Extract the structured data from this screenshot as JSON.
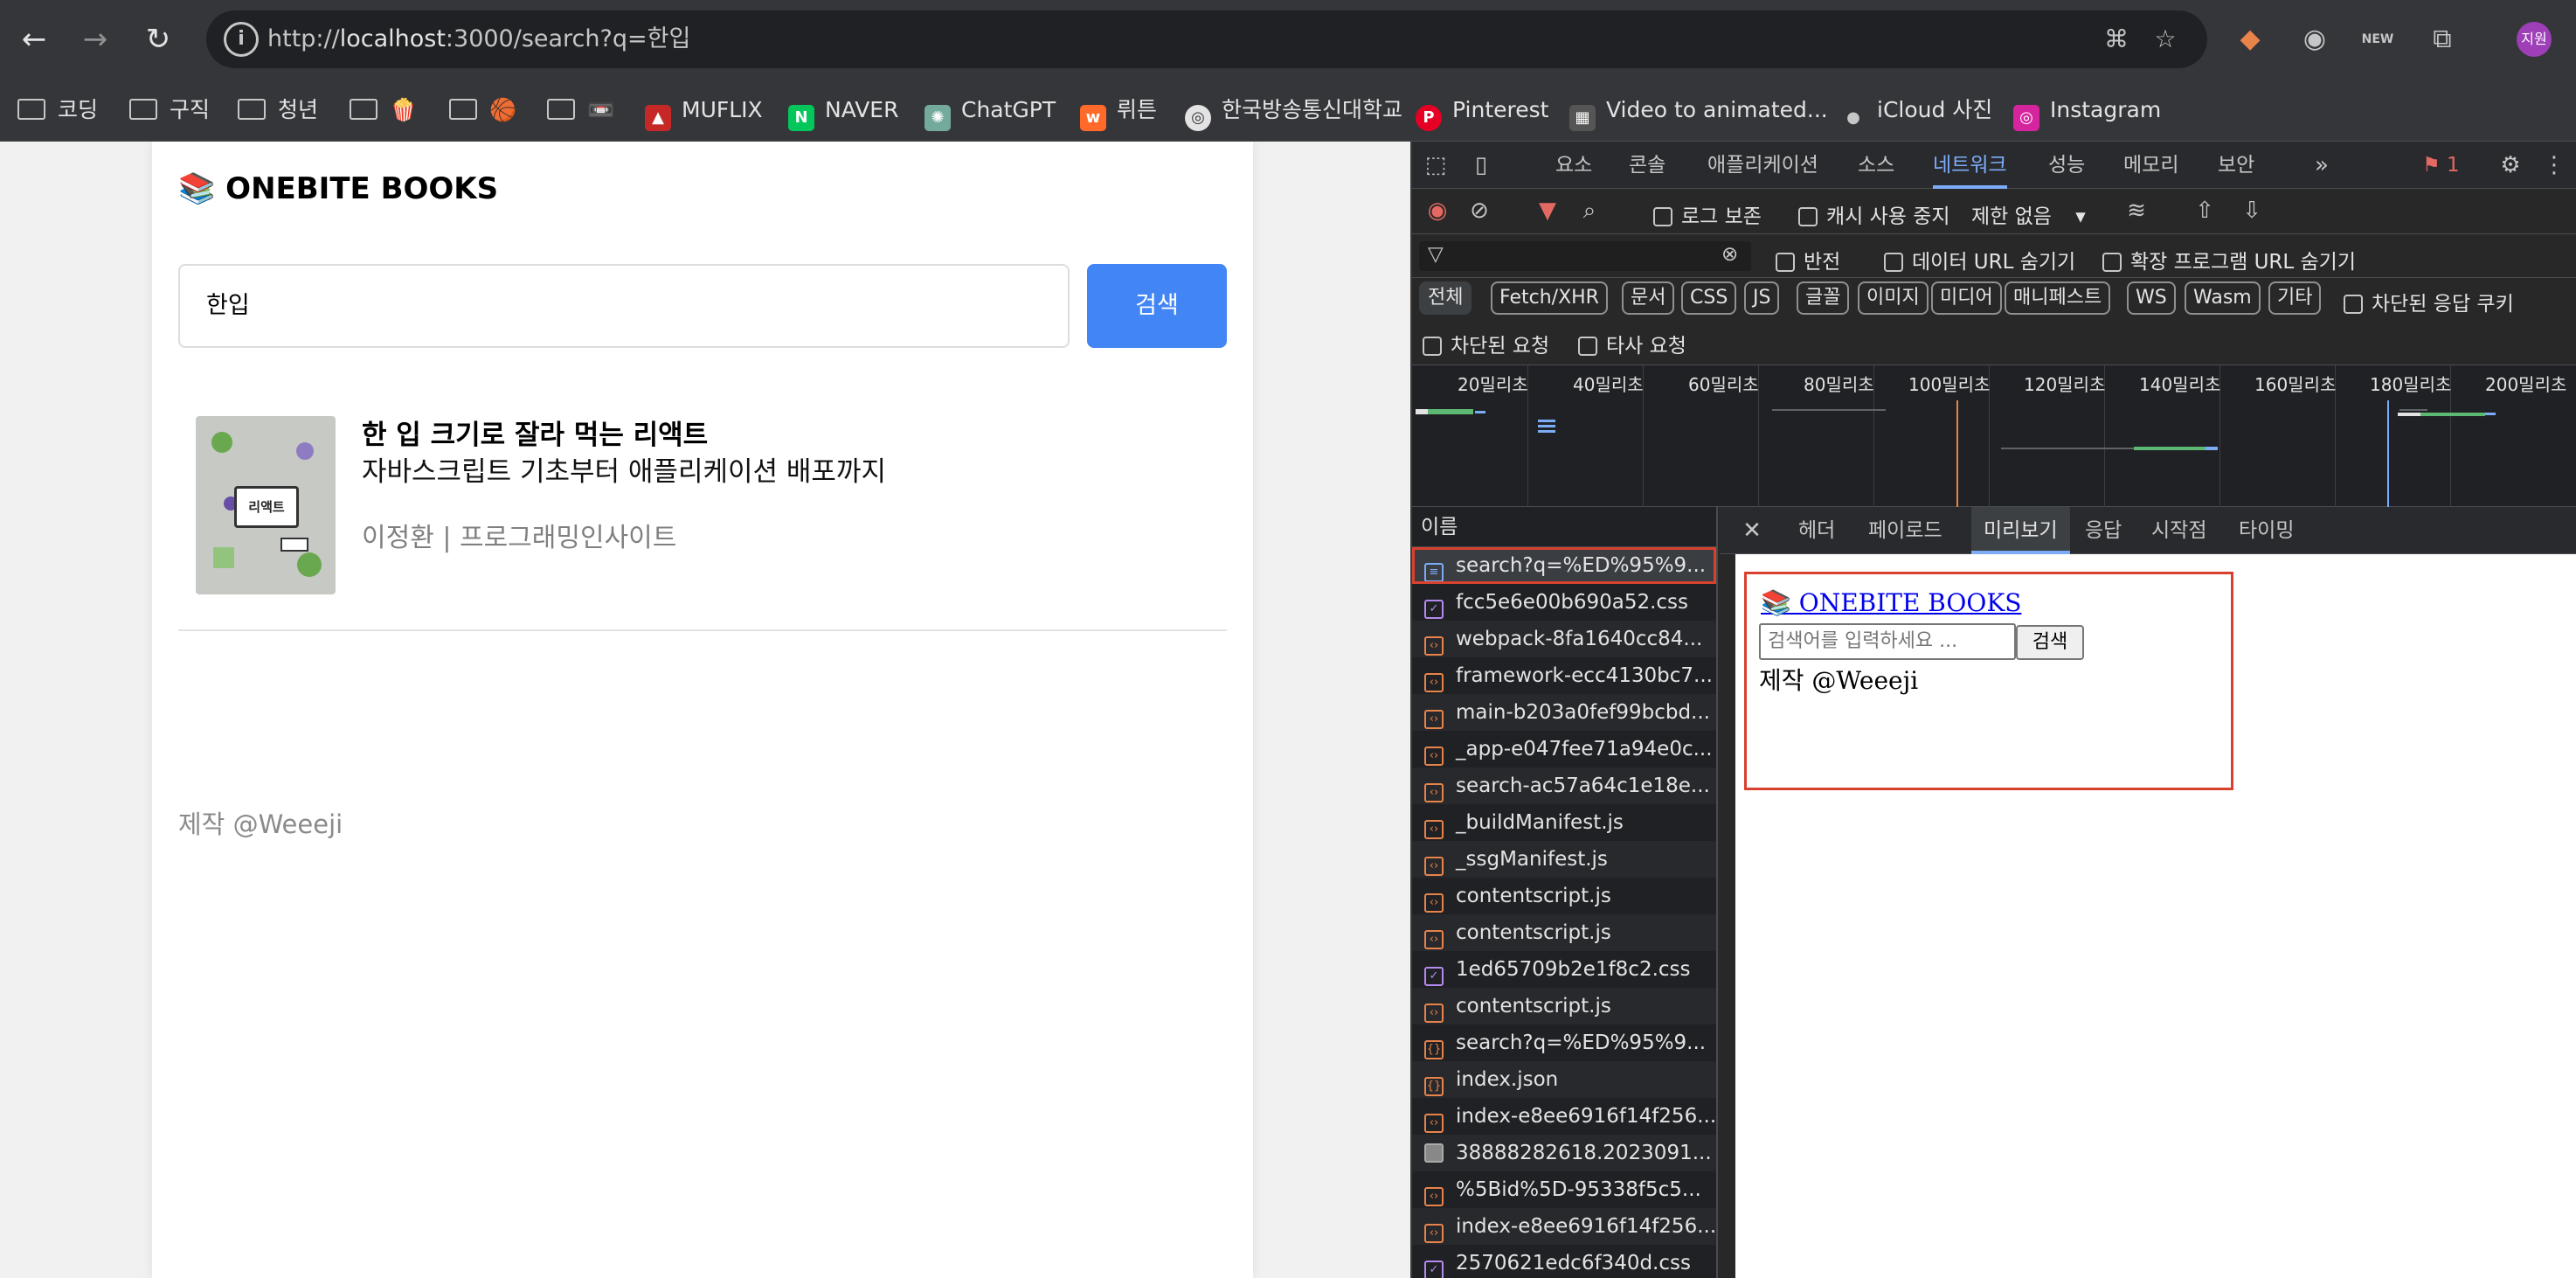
{
  "browser": {
    "url_scheme": "http://",
    "url_host": "localhost",
    "url_rest": ":3000/search?q=한입",
    "profile_initial": "지원",
    "extension_badge": "NEW"
  },
  "bookmarks": [
    {
      "label": "코딩",
      "type": "folder"
    },
    {
      "label": "구직",
      "type": "folder"
    },
    {
      "label": "청년",
      "type": "folder"
    },
    {
      "label": "🍿",
      "type": "folder"
    },
    {
      "label": "🏀",
      "type": "folder"
    },
    {
      "label": "📼",
      "type": "folder"
    },
    {
      "label": "MUFLIX",
      "type": "site"
    },
    {
      "label": "NAVER",
      "type": "site"
    },
    {
      "label": "ChatGPT",
      "type": "site"
    },
    {
      "label": "뤼튼",
      "type": "site"
    },
    {
      "label": "한국방송통신대학교",
      "type": "site"
    },
    {
      "label": "Pinterest",
      "type": "site"
    },
    {
      "label": "Video to animated...",
      "type": "site"
    },
    {
      "label": "iCloud 사진",
      "type": "site"
    },
    {
      "label": "Instagram",
      "type": "site"
    }
  ],
  "page": {
    "logo": "📚 ONEBITE BOOKS",
    "search_value": "한입",
    "search_button": "검색",
    "book": {
      "title": "한 입 크기로 잘라 먹는 리액트",
      "subtitle": "자바스크립트 기초부터 애플리케이션 배포까지",
      "author_publisher": "이정환 | 프로그래밍인사이트",
      "cover_text": "리액트"
    },
    "footer": "제작 @Weeeji"
  },
  "devtools": {
    "tabs": [
      "요소",
      "콘솔",
      "애플리케이션",
      "소스",
      "네트워크",
      "성능",
      "메모리",
      "보안"
    ],
    "active_tab": "네트워크",
    "issues_count": "1",
    "toolbar": {
      "preserve_log": "로그 보존",
      "disable_cache": "캐시 사용 중지",
      "throttle": "제한 없음"
    },
    "filter": {
      "invert": "반전",
      "hide_data_urls": "데이터 URL 숨기기",
      "hide_extension_urls": "확장 프로그램 URL 숨기기"
    },
    "type_chips": [
      "전체",
      "Fetch/XHR",
      "문서",
      "CSS",
      "JS",
      "글꼴",
      "이미지",
      "미디어",
      "매니페스트",
      "WS",
      "Wasm",
      "기타"
    ],
    "blocked_cookies": "차단된 응답 쿠키",
    "blocked_requests": "차단된 요청",
    "third_party": "타사 요청",
    "timeline_labels": [
      "20밀리초",
      "40밀리초",
      "60밀리초",
      "80밀리초",
      "100밀리초",
      "120밀리초",
      "140밀리초",
      "160밀리초",
      "180밀리초",
      "200밀리초"
    ],
    "name_header": "이름",
    "requests": [
      {
        "name": "search?q=%ED%95%9...",
        "kind": "doc"
      },
      {
        "name": "fcc5e6e00b690a52.css",
        "kind": "css"
      },
      {
        "name": "webpack-8fa1640cc84...",
        "kind": "js"
      },
      {
        "name": "framework-ecc4130bc7...",
        "kind": "js"
      },
      {
        "name": "main-b203a0fef99bcbd...",
        "kind": "js"
      },
      {
        "name": "_app-e047fee71a94e0c...",
        "kind": "js"
      },
      {
        "name": "search-ac57a64c1e18e...",
        "kind": "js"
      },
      {
        "name": "_buildManifest.js",
        "kind": "js"
      },
      {
        "name": "_ssgManifest.js",
        "kind": "js"
      },
      {
        "name": "contentscript.js",
        "kind": "js"
      },
      {
        "name": "contentscript.js",
        "kind": "js"
      },
      {
        "name": "1ed65709b2e1f8c2.css",
        "kind": "css"
      },
      {
        "name": "contentscript.js",
        "kind": "js"
      },
      {
        "name": "search?q=%ED%95%9...",
        "kind": "json"
      },
      {
        "name": "index.json",
        "kind": "json"
      },
      {
        "name": "index-e8ee6916f14f256...",
        "kind": "js"
      },
      {
        "name": "38888282618.2023091...",
        "kind": "img"
      },
      {
        "name": "%5Bid%5D-95338f5c5...",
        "kind": "js"
      },
      {
        "name": "index-e8ee6916f14f256...",
        "kind": "js"
      },
      {
        "name": "2570621edc6f340d.css",
        "kind": "css"
      }
    ],
    "detail_tabs": [
      "헤더",
      "페이로드",
      "미리보기",
      "응답",
      "시작점",
      "타이밍"
    ],
    "active_detail_tab": "미리보기",
    "preview": {
      "logo": "📚 ONEBITE BOOKS",
      "input_placeholder": "검색어를 입력하세요 ...",
      "button": "검색",
      "footer": "제작 @Weeeji"
    }
  }
}
